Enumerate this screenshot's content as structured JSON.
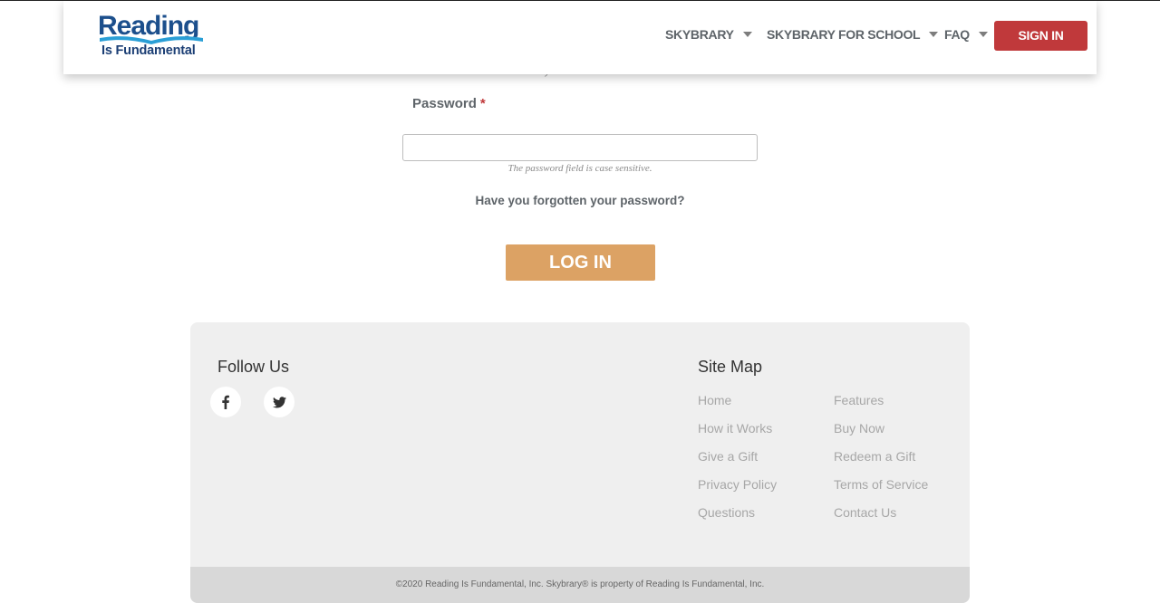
{
  "header": {
    "logo": {
      "top": "Reading",
      "bottom": "Is Fundamental"
    },
    "nav": [
      {
        "label": "SKYBRARY"
      },
      {
        "label": "SKYBRARY FOR SCHOOL"
      },
      {
        "label": "FAQ"
      }
    ],
    "signin_label": "SIGN IN"
  },
  "form": {
    "email_hint_cut": "Use your e-mail address.",
    "password_label": "Password",
    "required_mark": "*",
    "password_value": "",
    "password_hint": "The password field is case sensitive.",
    "forgot_link": "Have you forgotten your password?",
    "login_label": "LOG IN"
  },
  "footer": {
    "follow_title": "Follow Us",
    "social": [
      "facebook-icon",
      "twitter-icon"
    ],
    "sitemap_title": "Site Map",
    "links_col1": [
      "Home",
      "How it Works",
      "Give a Gift",
      "Privacy Policy",
      "Questions"
    ],
    "links_col2": [
      "Features",
      "Buy Now",
      "Redeem a Gift",
      "Terms of Service",
      "Contact Us"
    ],
    "copyright": "©2020 Reading Is Fundamental, Inc. Skybrary® is property of Reading Is Fundamental, Inc."
  },
  "colors": {
    "brand_red": "#c0393b",
    "login_orange": "#dca264",
    "logo_blue": "#1c4f8c"
  }
}
